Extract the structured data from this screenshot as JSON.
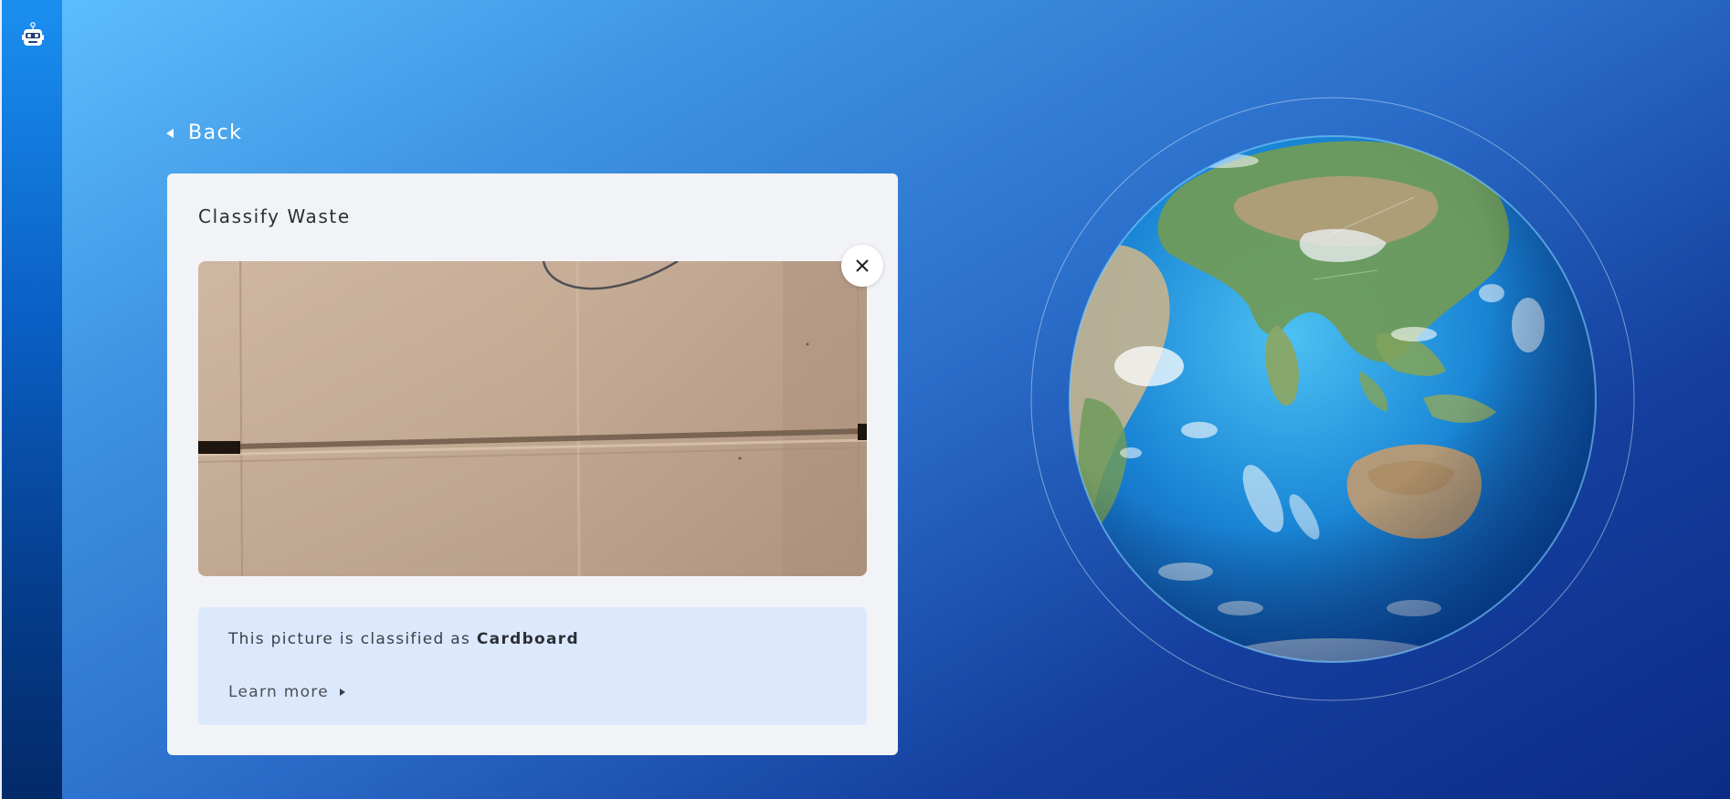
{
  "navigation": {
    "back_label": "Back"
  },
  "card": {
    "title": "Classify Waste",
    "result_prefix": "This picture is classified as",
    "result_class": "Cardboard",
    "learn_more_label": "Learn more"
  },
  "icons": {
    "logo": "robot-mascot-icon",
    "back": "triangle-left-icon",
    "close": "close-icon",
    "learn_more": "triangle-right-icon"
  },
  "colors": {
    "background_light": "#5ec1ff",
    "background_dark": "#0a2c86",
    "card_bg": "#f2f3f6",
    "result_bg": "#dce9fd"
  }
}
